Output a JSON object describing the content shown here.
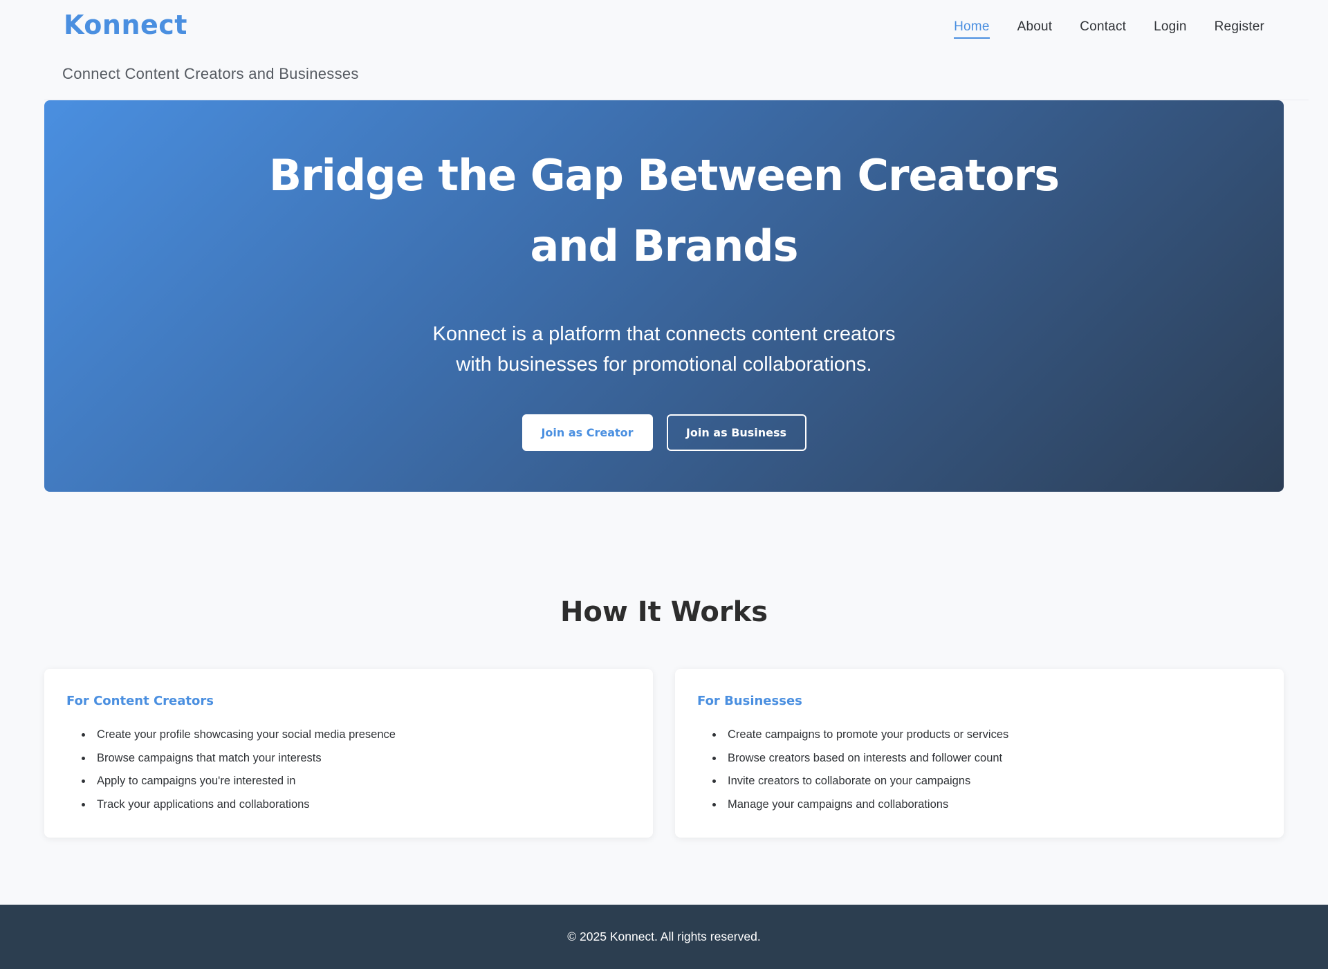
{
  "header": {
    "logo": "Konnect",
    "tagline": "Connect Content Creators and Businesses",
    "nav": [
      "Home",
      "About",
      "Contact",
      "Login",
      "Register"
    ],
    "active_nav": "Home"
  },
  "hero": {
    "title": "Bridge the Gap Between Creators and Brands",
    "subtitle": "Konnect is a platform that connects content creators with businesses for promotional collaborations.",
    "primary_button": "Join as Creator",
    "secondary_button": "Join as Business"
  },
  "how_it_works": {
    "title": "How It Works",
    "cards": [
      {
        "title": "For Content Creators",
        "items": [
          "Create your profile showcasing your social media presence",
          "Browse campaigns that match your interests",
          "Apply to campaigns you're interested in",
          "Track your applications and collaborations"
        ]
      },
      {
        "title": "For Businesses",
        "items": [
          "Create campaigns to promote your products or services",
          "Browse creators based on interests and follower count",
          "Invite creators to collaborate on your campaigns",
          "Manage your campaigns and collaborations"
        ]
      }
    ]
  },
  "footer": {
    "text": "© 2025 Konnect. All rights reserved."
  },
  "colors": {
    "accent": "#4a8fe0",
    "hero_gradient_start": "#4a8fe0",
    "hero_gradient_end": "#2c3e55",
    "footer_bg": "#2c3e50",
    "page_bg": "#f8f9fb"
  }
}
